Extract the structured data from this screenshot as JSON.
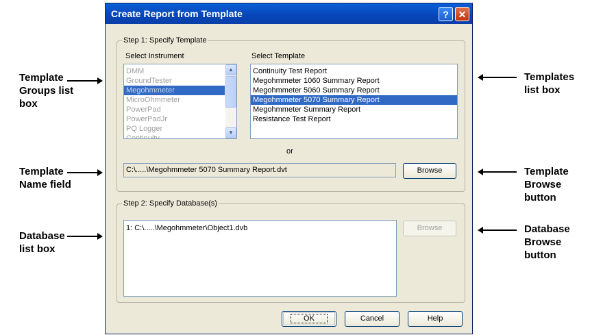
{
  "callouts": {
    "template_groups": [
      "Template",
      "Groups list",
      "box"
    ],
    "template_name": [
      "Template",
      "Name field"
    ],
    "database_list": [
      "Database",
      "list box"
    ],
    "templates_list": [
      "Templates",
      "list box"
    ],
    "template_browse": [
      "Template",
      "Browse",
      "button"
    ],
    "database_browse": [
      "Database",
      "Browse",
      "button"
    ]
  },
  "dialog": {
    "title": "Create Report from Template",
    "help_glyph": "?",
    "close_glyph": "✕",
    "step1": {
      "legend": "Step 1: Specify Template",
      "instrument_label": "Select Instrument",
      "template_label": "Select Template",
      "instruments": [
        "DMM",
        "GroundTester",
        "Megohmmeter",
        "MicroOhmmeter",
        "PowerPad",
        "PowerPadJr",
        "PQ Logger",
        "Continuity..."
      ],
      "selected_instrument": "Megohmmeter",
      "templates": [
        "Continuity Test Report",
        "Megohmmeter 1060 Summary Report",
        "Megohmmeter 5060 Summary Report",
        "Megohmmeter 5070 Summary Report",
        "Megohmmeter Summary Report",
        "Resistance Test Report"
      ],
      "selected_template": "Megohmmeter 5070 Summary Report",
      "or_label": "or",
      "template_path": "C:\\.....\\Megohmmeter 5070 Summary Report.dvt",
      "browse_label": "Browse"
    },
    "step2": {
      "legend": "Step 2: Specify Database(s)",
      "databases": [
        "1: C:\\.....\\Megohmmeter\\Object1.dvb"
      ],
      "browse_label": "Browse"
    },
    "buttons": {
      "ok": "OK",
      "cancel": "Cancel",
      "help": "Help"
    }
  },
  "colors": {
    "title_bar": "#0a5fd8",
    "selection": "#316ac5",
    "dialog_bg": "#ece9d8"
  }
}
